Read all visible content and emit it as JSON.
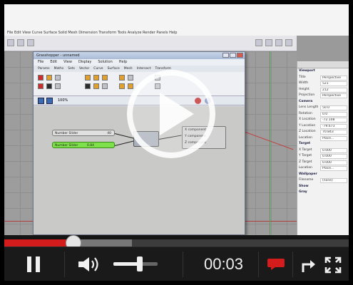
{
  "rhino": {
    "menu_text": "File  Edit  View  Curve  Surface  Solid  Mesh  Dimension  Transform  Tools  Analyze  Render  Panels  Help",
    "toolbar_text": "",
    "properties": {
      "tabs_text": "",
      "rows": [
        {
          "k": "Viewport",
          "v": ""
        },
        {
          "k": "Title",
          "v": "Perspective"
        },
        {
          "k": "Width",
          "v": "521"
        },
        {
          "k": "Height",
          "v": "212"
        },
        {
          "k": "Projection",
          "v": "Perspective"
        },
        {
          "k": "Camera",
          "v": ""
        },
        {
          "k": "Lens Length",
          "v": "50.0"
        },
        {
          "k": "Rotation",
          "v": "0.0"
        },
        {
          "k": "X Location",
          "v": "-72.108"
        },
        {
          "k": "Y Location",
          "v": "-79.673"
        },
        {
          "k": "Z Location",
          "v": "70.843"
        },
        {
          "k": "Location",
          "v": "Place..."
        },
        {
          "k": "Target",
          "v": ""
        },
        {
          "k": "X Target",
          "v": "0.000"
        },
        {
          "k": "Y Target",
          "v": "0.000"
        },
        {
          "k": "Z Target",
          "v": "0.000"
        },
        {
          "k": "Location",
          "v": "Place..."
        },
        {
          "k": "Wallpaper",
          "v": ""
        },
        {
          "k": "Filename",
          "v": "(none)"
        },
        {
          "k": "Show",
          "v": ""
        },
        {
          "k": "Gray",
          "v": ""
        }
      ]
    }
  },
  "grasshopper": {
    "title": "Grasshopper - unnamed",
    "menu": [
      "File",
      "Edit",
      "View",
      "Display",
      "Solution",
      "Help"
    ],
    "tabs": [
      "Params",
      "Maths",
      "Sets",
      "Vector",
      "Curve",
      "Surface",
      "Mesh",
      "Intersect",
      "Transform"
    ],
    "zoom": "100%",
    "nodes": {
      "slider1_label": "Number Slider",
      "slider1_value": "40",
      "slider2_label": "Number Slider",
      "slider2_value": "0.84",
      "out1": "X component",
      "out2": "Y component",
      "out3": "Z component"
    }
  },
  "player": {
    "time": "00:03",
    "progress": 0.2,
    "buffered": 0.37,
    "volume": 0.6
  },
  "colors": {
    "accent": "#d41c1c",
    "slider_green": "#7ee04a",
    "controls_bg": "#1a1a1a"
  },
  "icons": [
    "play-icon",
    "pause-icon",
    "volume-icon",
    "captions-icon",
    "share-icon",
    "fullscreen-icon"
  ]
}
